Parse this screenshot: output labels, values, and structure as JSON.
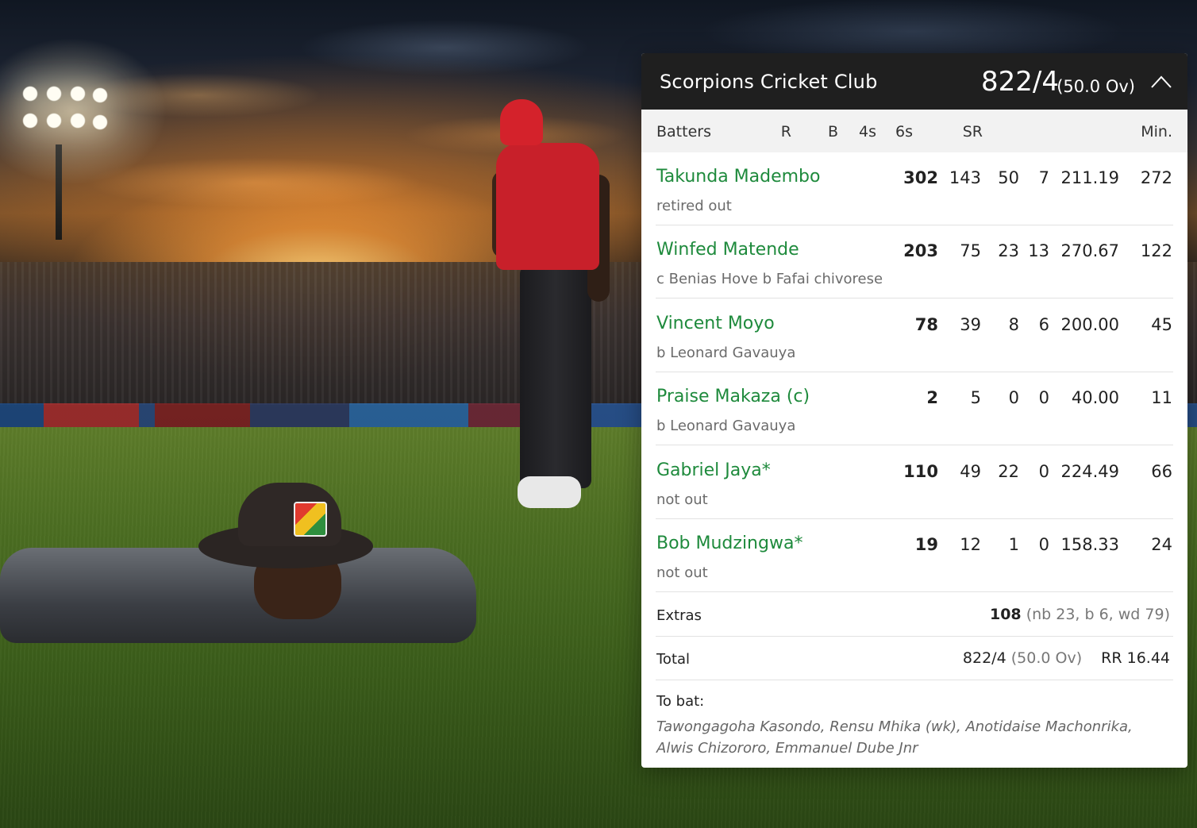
{
  "team": {
    "name": "Scorpions Cricket Club",
    "score": "822/4",
    "overs": "(50.0 Ov)"
  },
  "columns": {
    "batters": "Batters",
    "r": "R",
    "b": "B",
    "fours": "4s",
    "sixes": "6s",
    "sr": "SR",
    "min": "Min."
  },
  "batters": [
    {
      "name": "Takunda Madembo",
      "dismissal": "retired out",
      "r": "302",
      "b": "143",
      "fours": "50",
      "sixes": "7",
      "sr": "211.19",
      "min": "272"
    },
    {
      "name": "Winfed Matende",
      "dismissal": "c Benias Hove b Fafai chivorese",
      "r": "203",
      "b": "75",
      "fours": "23",
      "sixes": "13",
      "sr": "270.67",
      "min": "122"
    },
    {
      "name": "Vincent Moyo",
      "dismissal": "b Leonard Gavauya",
      "r": "78",
      "b": "39",
      "fours": "8",
      "sixes": "6",
      "sr": "200.00",
      "min": "45"
    },
    {
      "name": "Praise Makaza  (c)",
      "dismissal": "b Leonard Gavauya",
      "r": "2",
      "b": "5",
      "fours": "0",
      "sixes": "0",
      "sr": "40.00",
      "min": "11"
    },
    {
      "name": "Gabriel Jaya*",
      "dismissal": "not out",
      "r": "110",
      "b": "49",
      "fours": "22",
      "sixes": "0",
      "sr": "224.49",
      "min": "66"
    },
    {
      "name": "Bob Mudzingwa*",
      "dismissal": "not out",
      "r": "19",
      "b": "12",
      "fours": "1",
      "sixes": "0",
      "sr": "158.33",
      "min": "24"
    }
  ],
  "extras": {
    "label": "Extras",
    "value": "108",
    "detail": "(nb 23, b 6, wd 79)"
  },
  "total": {
    "label": "Total",
    "score": "822/4",
    "overs": "(50.0 Ov)",
    "rr": "RR 16.44"
  },
  "to_bat": {
    "label": "To bat:",
    "players": "Tawongagoha Kasondo, Rensu Mhika (wk), Anotidaise Machonrika, Alwis Chizororo, Emmanuel Dube Jnr"
  },
  "icons": {
    "collapse": "chevron-up-icon"
  },
  "colors": {
    "header_bg": "#1f1f1f",
    "batter_name": "#1e8a3c",
    "columns_bg": "#f2f2f2"
  }
}
